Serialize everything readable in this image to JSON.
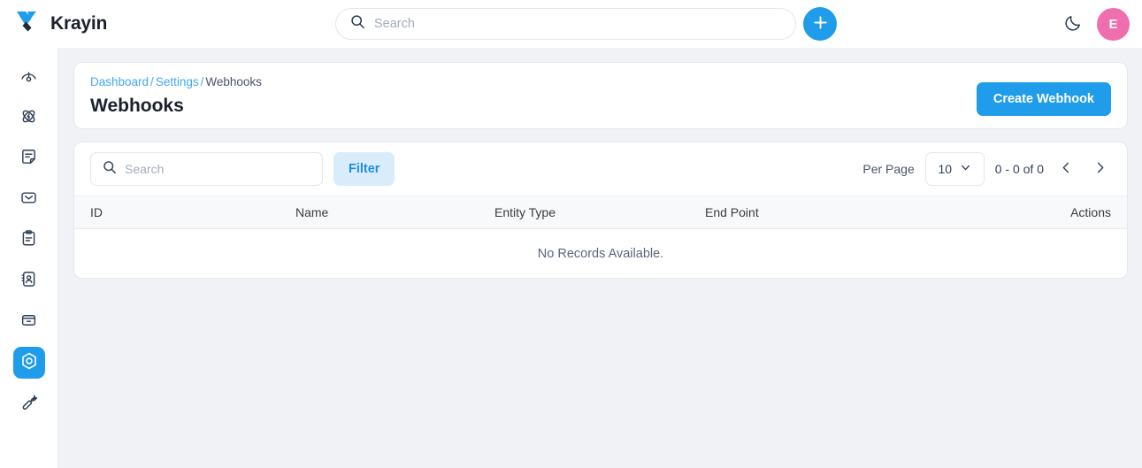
{
  "brand": {
    "name": "Krayin",
    "logo_icon": "krayin-diamond-logo"
  },
  "header": {
    "search": {
      "placeholder": "Search",
      "value": "",
      "icon": "search-icon"
    },
    "add_button_icon": "plus-icon",
    "theme_toggle_icon": "moon-icon",
    "avatar_initial": "E"
  },
  "sidebar": {
    "items": [
      {
        "name": "dashboard",
        "icon": "gauge-icon",
        "active": false
      },
      {
        "name": "leads",
        "icon": "atom-icon",
        "active": false
      },
      {
        "name": "quotes",
        "icon": "note-icon",
        "active": false
      },
      {
        "name": "mail",
        "icon": "envelope-icon",
        "active": false
      },
      {
        "name": "activities",
        "icon": "clipboard-icon",
        "active": false
      },
      {
        "name": "contacts",
        "icon": "contact-book-icon",
        "active": false
      },
      {
        "name": "products",
        "icon": "box-icon",
        "active": false
      },
      {
        "name": "settings",
        "icon": "hexagon-gear-icon",
        "active": true
      },
      {
        "name": "configuration",
        "icon": "wrench-icon",
        "active": false
      }
    ]
  },
  "page": {
    "breadcrumb": [
      {
        "label": "Dashboard",
        "link": true
      },
      {
        "label": "Settings",
        "link": true
      },
      {
        "label": "Webhooks",
        "link": false
      }
    ],
    "breadcrumb_separator": "/",
    "title": "Webhooks",
    "create_button": "Create Webhook"
  },
  "toolbar": {
    "search": {
      "placeholder": "Search",
      "value": "",
      "icon": "search-icon"
    },
    "filter_label": "Filter",
    "per_page_label": "Per Page",
    "per_page_value": "10",
    "per_page_chevron_icon": "chevron-down-icon",
    "record_count": "0 - 0 of 0",
    "prev_icon": "chevron-left-icon",
    "next_icon": "chevron-right-icon"
  },
  "table": {
    "columns": [
      "ID",
      "Name",
      "Entity Type",
      "End Point",
      "Actions"
    ],
    "rows": [],
    "empty_message": "No Records Available."
  },
  "colors": {
    "accent": "#1f9cea",
    "link": "#3fa9f5",
    "filter_bg": "#d9ecfb",
    "avatar_bg": "#ef6fae",
    "content_bg": "#f1f2f5",
    "icon_stroke": "#2c3e56"
  }
}
